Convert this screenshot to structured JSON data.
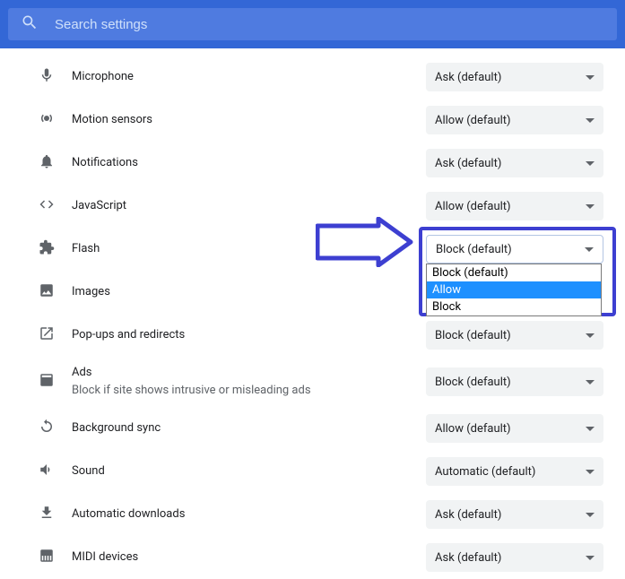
{
  "search": {
    "placeholder": "Search settings"
  },
  "rows": {
    "microphone": {
      "label": "Microphone",
      "value": "Ask (default)"
    },
    "motion": {
      "label": "Motion sensors",
      "value": "Allow (default)"
    },
    "notifications": {
      "label": "Notifications",
      "value": "Ask (default)"
    },
    "javascript": {
      "label": "JavaScript",
      "value": "Allow (default)"
    },
    "flash": {
      "label": "Flash",
      "value": "Block (default)",
      "options": [
        "Block (default)",
        "Allow",
        "Block"
      ]
    },
    "images": {
      "label": "Images"
    },
    "popups": {
      "label": "Pop-ups and redirects",
      "value": "Block (default)"
    },
    "ads": {
      "label": "Ads",
      "sub": "Block if site shows intrusive or misleading ads",
      "value": "Block (default)"
    },
    "bgsync": {
      "label": "Background sync",
      "value": "Allow (default)"
    },
    "sound": {
      "label": "Sound",
      "value": "Automatic (default)"
    },
    "autodl": {
      "label": "Automatic downloads",
      "value": "Ask (default)"
    },
    "midi": {
      "label": "MIDI devices",
      "value": "Ask (default)"
    }
  }
}
